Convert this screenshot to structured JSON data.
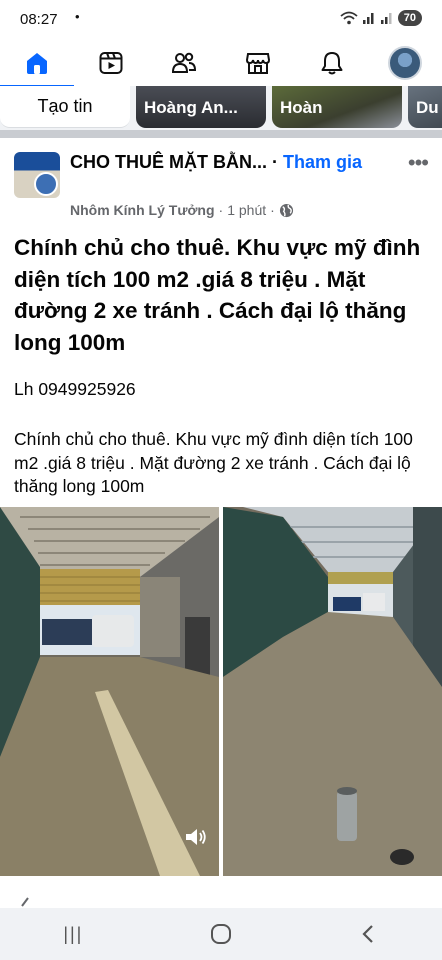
{
  "status_bar": {
    "time": "08:27",
    "dot": "•",
    "battery": "70"
  },
  "top_nav": {
    "tabs": [
      "home-icon",
      "video-icon",
      "friends-icon",
      "marketplace-icon",
      "bell-icon",
      "profile-avatar"
    ],
    "active_color": "#0866ff"
  },
  "stories": {
    "create_label": "Tạo tin",
    "items": [
      {
        "name": "Hoàng An..."
      },
      {
        "name": "Hoàn"
      },
      {
        "name": "Du"
      }
    ]
  },
  "post": {
    "group_name": "CHO THUÊ MẶT BẰN...",
    "join_label": "Tham gia",
    "separator": "·",
    "author": "Nhôm Kính Lý Tưởng",
    "time": "1 phút",
    "headline": "Chính chủ cho thuê. Khu vực mỹ đình diện tích 100 m2 .giá 8 triệu . Mặt đường 2 xe tránh . Cách đại lộ thăng long 100m",
    "contact": "Lh 0949925926",
    "body": "Chính chủ cho thuê. Khu vực mỹ đình diện tích 100 m2 .giá 8 triệu . Mặt đường 2 xe tránh . Cách đại lộ thăng long 100m",
    "photos": [
      "warehouse-photo-entrance",
      "warehouse-photo-interior"
    ]
  },
  "android_nav": {
    "recent": "|||",
    "home": "◯",
    "back": "‹"
  },
  "colors": {
    "accent": "#0866ff",
    "meta_text": "#65676b",
    "divider": "#c9ccd1"
  }
}
